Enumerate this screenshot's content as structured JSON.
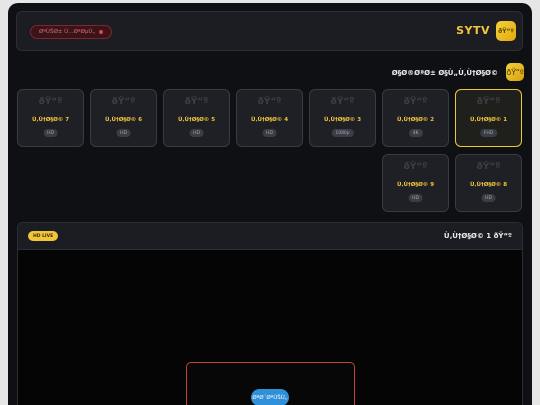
{
  "header": {
    "logo_mark": "ðŸ“º",
    "logo_text": "SYTV",
    "status_label": "ØºÙŠØ± Ù…ØªØµÙ„"
  },
  "section": {
    "title": "Ø§Ø®ØªØ± Ø§Ù„Ù‚Ù†Ø§Ø©",
    "icon": "ðŸ“º"
  },
  "channels": [
    {
      "name": "Ù‚Ù†Ø§Ø© 1",
      "quality": "FHD",
      "active": true
    },
    {
      "name": "Ù‚Ù†Ø§Ø© 2",
      "quality": "4K"
    },
    {
      "name": "Ù‚Ù†Ø§Ø© 3",
      "quality": "1080p"
    },
    {
      "name": "Ù‚Ù†Ø§Ø© 4",
      "quality": "HD"
    },
    {
      "name": "Ù‚Ù†Ø§Ø© 5",
      "quality": "HD"
    },
    {
      "name": "Ù‚Ù†Ø§Ø© 6",
      "quality": "HD"
    },
    {
      "name": "Ù‚Ù†Ø§Ø© 7",
      "quality": "HD"
    },
    {
      "name": "Ù‚Ù†Ø§Ø© 8",
      "quality": "HD"
    },
    {
      "name": "Ù‚Ù†Ø§Ø© 9",
      "quality": "HD"
    }
  ],
  "card_watermark": "ðŸ“º",
  "player": {
    "badge": "HD LIVE",
    "title": "Ù‚Ù†Ø§Ø© 1 ðŸ“º",
    "play_label": "ØªØ´ØºÙŠÙ„"
  },
  "colors": {
    "accent": "#f0c53a",
    "background": "#0f1014",
    "card": "#1e2026",
    "danger": "#e2404f",
    "play": "#2f8fd8"
  }
}
